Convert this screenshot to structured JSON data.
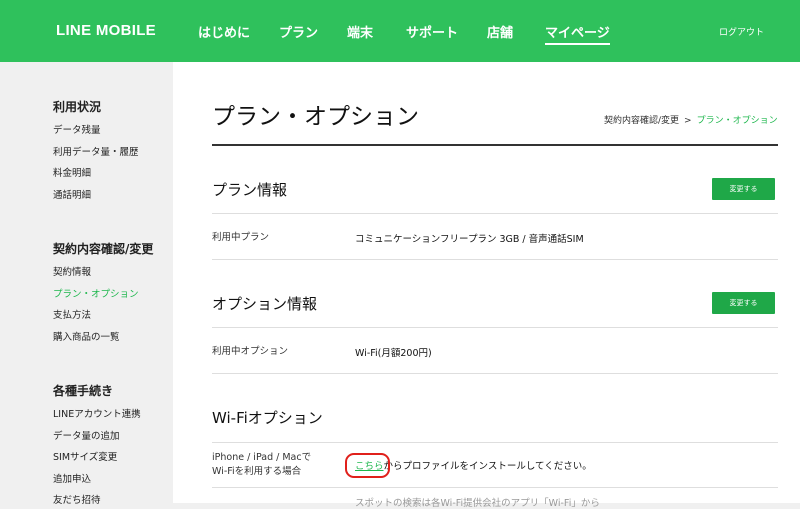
{
  "header": {
    "logo": "LINE MOBILE",
    "nav": [
      "はじめに",
      "プラン",
      "端末",
      "サポート",
      "店舗",
      "マイページ"
    ],
    "logout": "ログアウト"
  },
  "sidebar": {
    "groups": [
      {
        "title": "利用状況",
        "items": [
          "データ残量",
          "利用データ量・履歴",
          "料金明細",
          "通話明細"
        ]
      },
      {
        "title": "契約内容確認/変更",
        "items": [
          "契約情報",
          "プラン・オプション",
          "支払方法",
          "購入商品の一覧"
        ]
      },
      {
        "title": "各種手続き",
        "items": [
          "LINEアカウント連携",
          "データ量の追加",
          "SIMサイズ変更",
          "追加申込",
          "友だち招待"
        ]
      }
    ]
  },
  "main": {
    "title": "プラン・オプション",
    "breadcrumb": {
      "parent": "契約内容確認/変更",
      "sep": ">",
      "current": "プラン・オプション"
    },
    "plan": {
      "title": "プラン情報",
      "button": "変更する",
      "label": "利用中プラン",
      "value": "コミュニケーションフリープラン 3GB / 音声通話SIM"
    },
    "option": {
      "title": "オプション情報",
      "button": "変更する",
      "label": "利用中オプション",
      "value": "Wi-Fi(月額200円)"
    },
    "wifi": {
      "title": "Wi-Fiオプション",
      "label_line1": "iPhone / iPad / Macで",
      "label_line2": "Wi-Fiを利用する場合",
      "link": "こちら",
      "value_rest": "からプロファイルをインストールしてください。",
      "faded_line": "スポットの検索は各Wi-Fi提供会社のアプリ「Wi-Fi」から"
    }
  }
}
